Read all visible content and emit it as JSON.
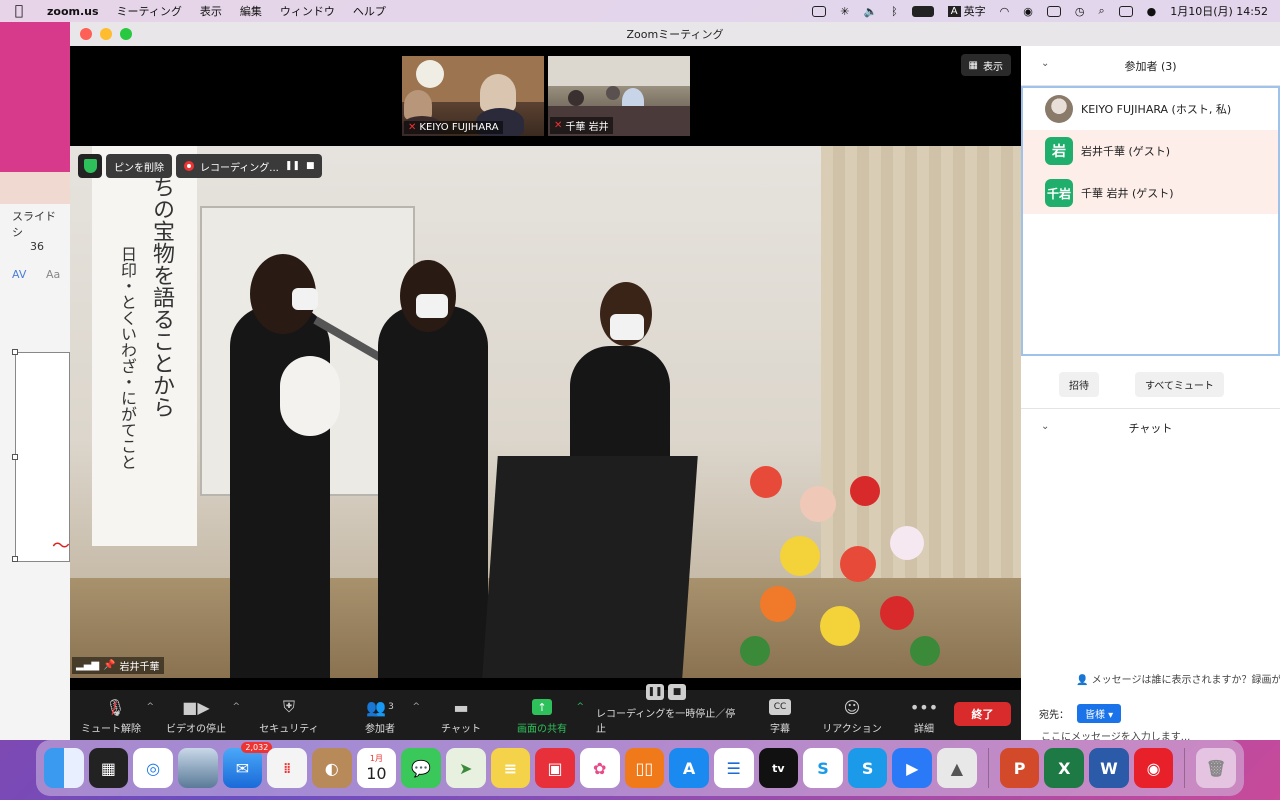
{
  "menubar": {
    "app": "zoom.us",
    "items": [
      "ミーティング",
      "表示",
      "編集",
      "ウィンドウ",
      "ヘルプ"
    ],
    "input_mode": "英字",
    "datetime": "1月10日(月)  14:52"
  },
  "bg_window": {
    "toolbar_label": "スライド シ",
    "font_size": "36",
    "av_label": "AV",
    "aa_label": "Aa"
  },
  "window": {
    "title": "Zoomミーティング"
  },
  "thumbnails": [
    {
      "name": "KEIYO FUJIHARA"
    },
    {
      "name": "千華 岩井"
    }
  ],
  "view_button": "表示",
  "overlay": {
    "unpin": "ピンを削除",
    "recording": "レコーディング..."
  },
  "main_video": {
    "speaker": "岩井千華",
    "banner_line1": "ちの宝物を語ることから",
    "banner_line2": "日印・とくいわざ・にがてこと"
  },
  "toolbar": {
    "unmute": "ミュート解除",
    "stop_video": "ビデオの停止",
    "security": "セキュリティ",
    "participants": "参加者",
    "participants_count": "3",
    "chat": "チャット",
    "share": "画面の共有",
    "recording": "レコーディングを一時停止／停止",
    "captions": "字幕",
    "cc": "CC",
    "reactions": "リアクション",
    "more": "詳細",
    "end": "終了"
  },
  "panel": {
    "participants_header": "参加者 (3)",
    "participants": [
      {
        "avatar": "",
        "name": "KEIYO FUJIHARA (ホスト, 私)"
      },
      {
        "avatar": "岩",
        "name": "岩井千華 (ゲスト)"
      },
      {
        "avatar": "千岩",
        "name": "千華 岩井 (ゲスト)"
      }
    ],
    "invite": "招待",
    "mute_all": "すべてミュート",
    "chat_header": "チャット",
    "who_can_see": "メッセージは誰に表示されますか？録画が",
    "send_to_label": "宛先：",
    "everyone": "皆様",
    "input_placeholder": "ここにメッセージを入力します..."
  },
  "dock": {
    "mail_badge": "2,032",
    "calendar_month": "1月",
    "calendar_day": "10",
    "tv_label": "tv"
  }
}
